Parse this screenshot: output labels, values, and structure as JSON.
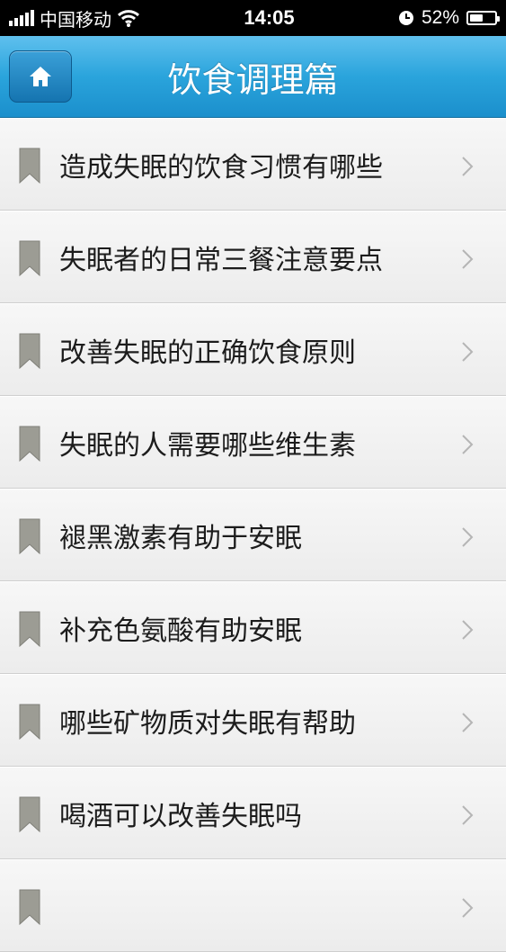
{
  "status_bar": {
    "carrier": "中国移动",
    "time": "14:05",
    "battery_percent": "52%",
    "battery_level": 0.52,
    "signal_bars": 5,
    "icons": [
      "signal-icon",
      "wifi-icon",
      "clock-icon",
      "battery-icon"
    ]
  },
  "header": {
    "title": "饮食调理篇",
    "home_icon": "home-icon"
  },
  "colors": {
    "nav_bar": "#2aa4dc",
    "list_background": "#efefef",
    "bookmark": "#9c9c94",
    "chevron": "#b5b5b5",
    "text": "#1c1c1c"
  },
  "list": {
    "items": [
      {
        "label": "造成失眠的饮食习惯有哪些"
      },
      {
        "label": "失眠者的日常三餐注意要点"
      },
      {
        "label": "改善失眠的正确饮食原则"
      },
      {
        "label": "失眠的人需要哪些维生素"
      },
      {
        "label": "褪黑激素有助于安眠"
      },
      {
        "label": "补充色氨酸有助安眠"
      },
      {
        "label": "哪些矿物质对失眠有帮助"
      },
      {
        "label": "喝酒可以改善失眠吗"
      },
      {
        "label": ""
      }
    ]
  }
}
